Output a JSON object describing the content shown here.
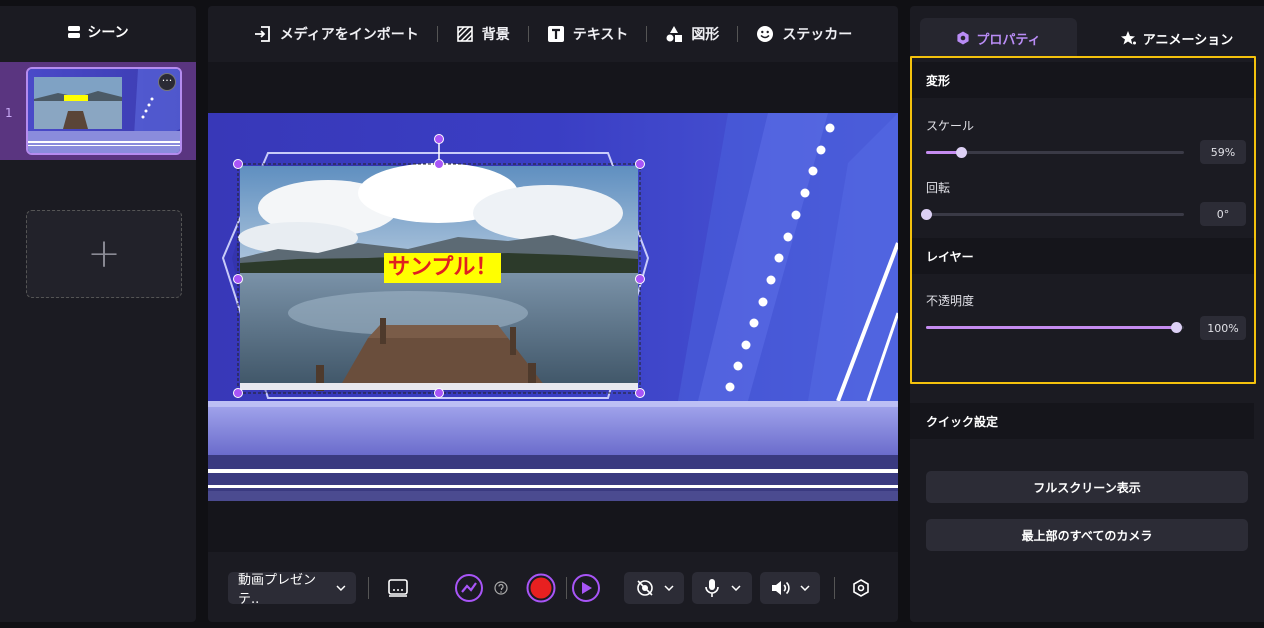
{
  "left": {
    "title": "シーン",
    "scene_number": "1"
  },
  "toolbar": {
    "import": "メディアをインポート",
    "background": "背景",
    "text": "テキスト",
    "shape": "図形",
    "sticker": "ステッカー"
  },
  "stage": {
    "caption": "サンプル！"
  },
  "bottom": {
    "mode": "動画プレゼンテ.."
  },
  "right": {
    "tab_properties": "プロパティ",
    "tab_animation": "アニメーション",
    "transform": "変形",
    "scale_label": "スケール",
    "scale_value": "59%",
    "scale_fraction": 0.59,
    "rotate_label": "回転",
    "rotate_value": "0°",
    "rotate_fraction": 0.0,
    "layer": "レイヤー",
    "opacity_label": "不透明度",
    "opacity_value": "100%",
    "opacity_fraction": 1.0,
    "quick": "クイック設定",
    "fullscreen": "フルスクリーン表示",
    "all_cameras": "最上部のすべてのカメラ"
  },
  "colors": {
    "accent": "#b98cf5",
    "record": "#e82020",
    "highlight": "#f4c20d"
  }
}
